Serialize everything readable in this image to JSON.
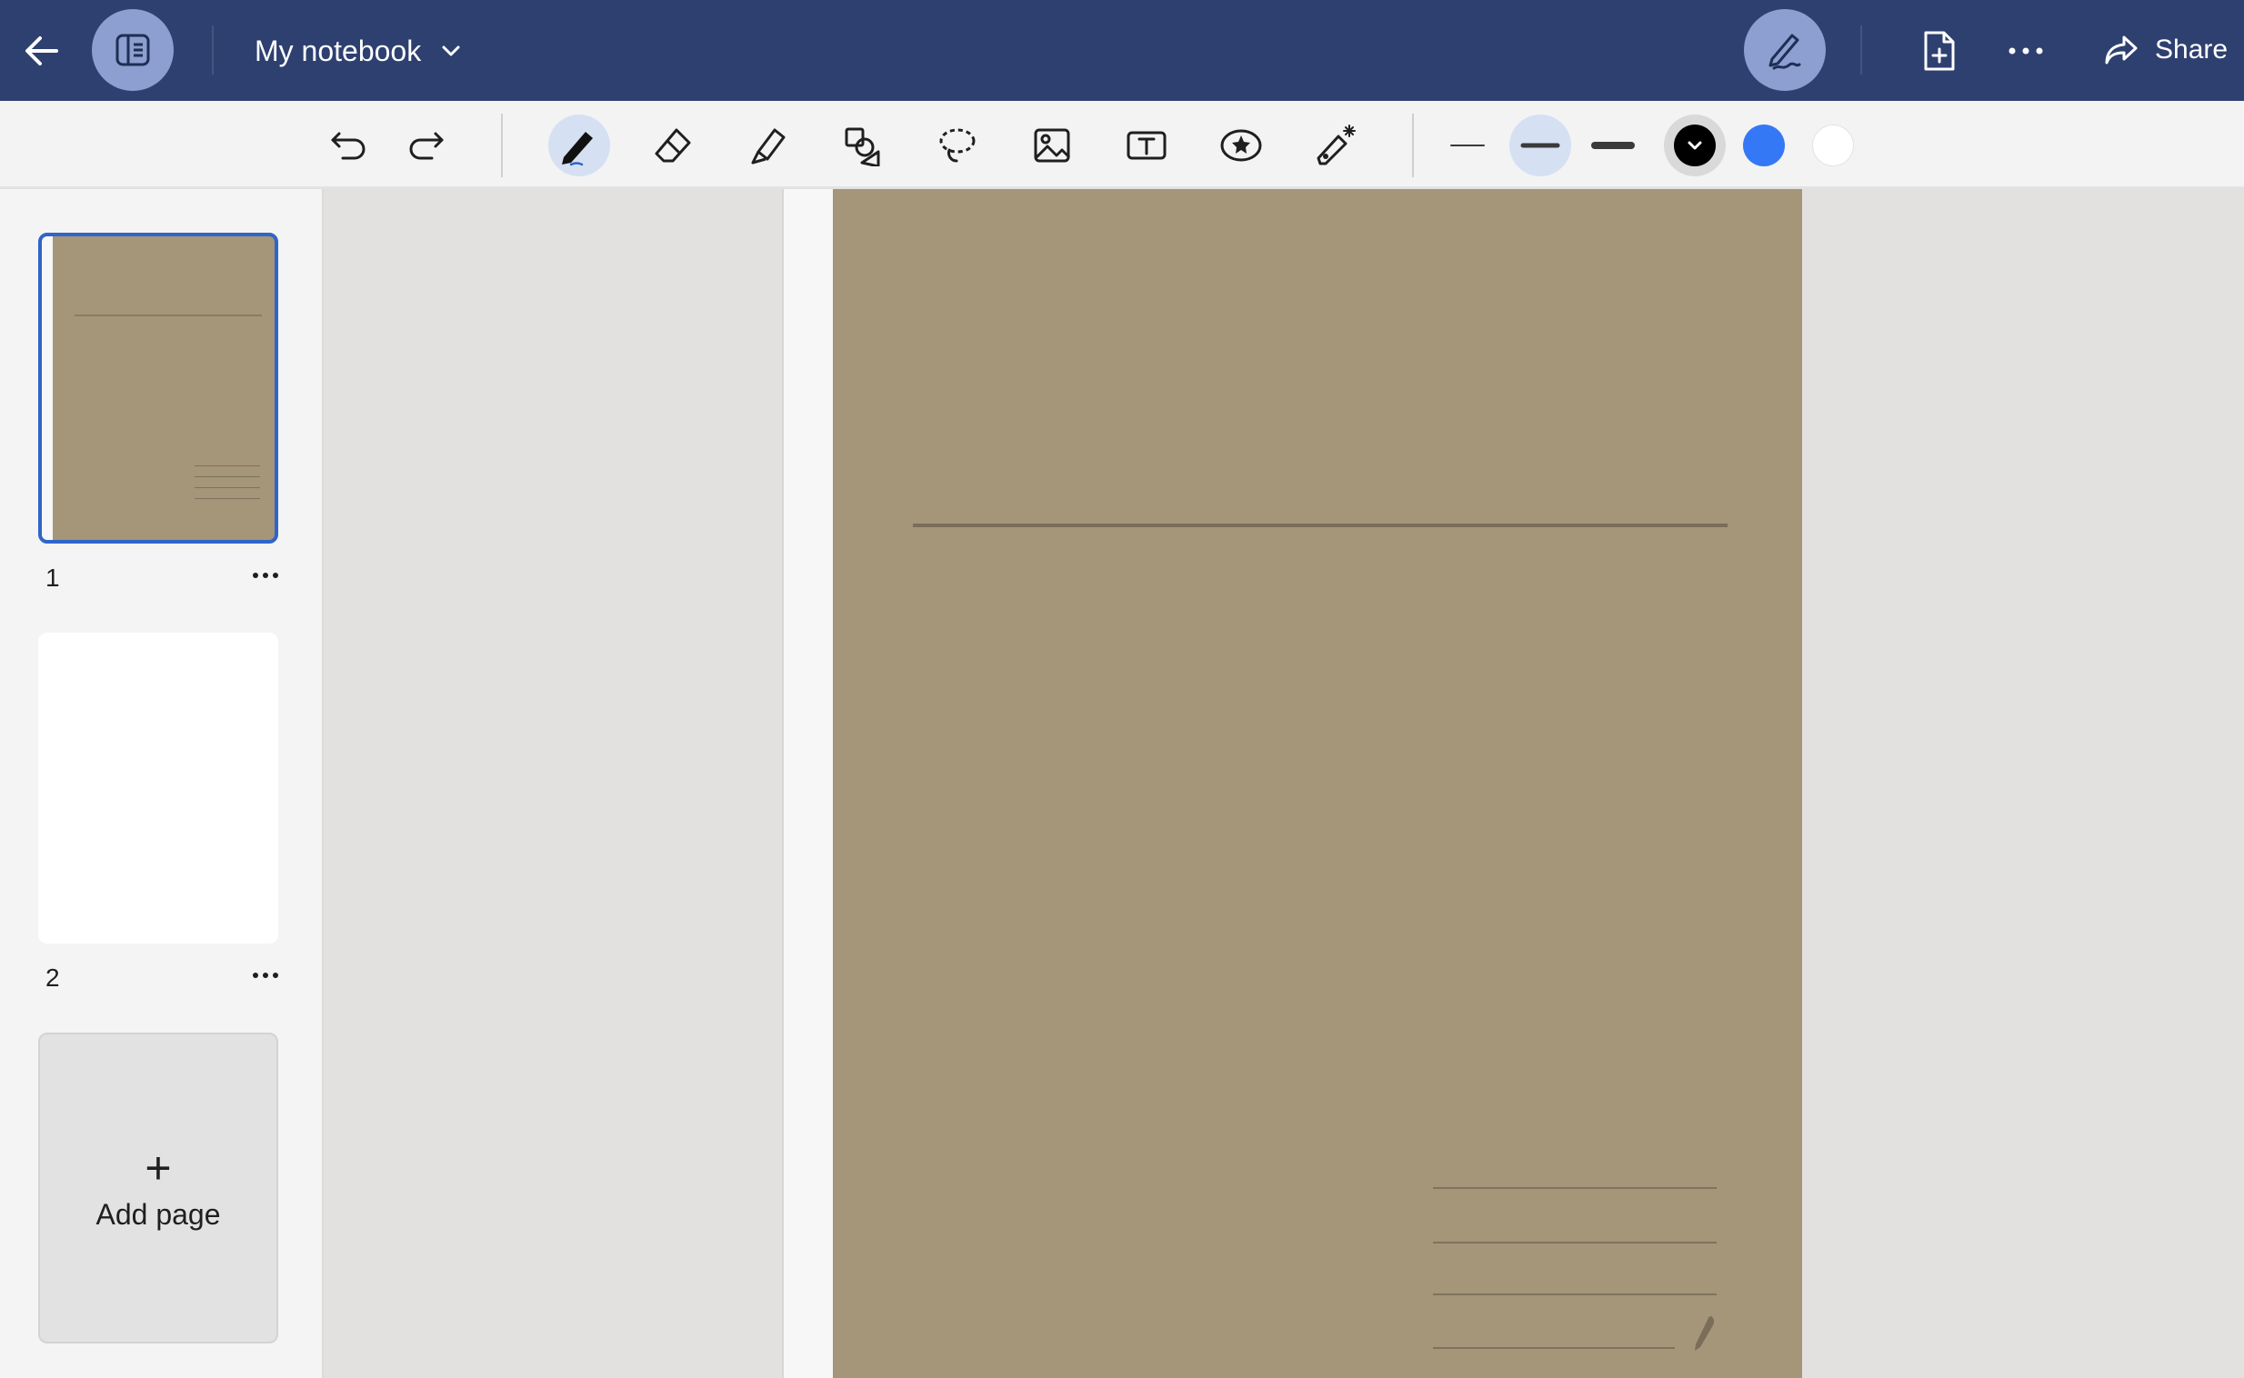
{
  "header": {
    "notebook_title": "My notebook",
    "share_label": "Share"
  },
  "icons": {
    "back": "arrow-left-icon",
    "sidebar_toggle": "sidebar-panel-icon",
    "title_dropdown": "chevron-down-icon",
    "pen_mode": "pen-edit-icon",
    "add_file": "file-plus-icon",
    "more": "more-horizontal-icon",
    "share": "share-arrow-icon"
  },
  "toolbar": {
    "history": [
      "undo-icon",
      "redo-icon"
    ],
    "tools": [
      {
        "name": "pen",
        "icon": "pen-icon",
        "active": true
      },
      {
        "name": "eraser",
        "icon": "eraser-icon",
        "active": false
      },
      {
        "name": "highlighter",
        "icon": "highlighter-icon",
        "active": false
      },
      {
        "name": "shapes",
        "icon": "shapes-icon",
        "active": false
      },
      {
        "name": "lasso",
        "icon": "lasso-icon",
        "active": false
      },
      {
        "name": "image",
        "icon": "image-icon",
        "active": false
      },
      {
        "name": "text",
        "icon": "text-box-icon",
        "active": false
      },
      {
        "name": "sticker",
        "icon": "sticker-icon",
        "active": false
      },
      {
        "name": "magic",
        "icon": "magic-pen-icon",
        "active": false
      }
    ],
    "thickness": [
      {
        "name": "thin",
        "active": false
      },
      {
        "name": "medium",
        "active": true
      },
      {
        "name": "thick",
        "active": false
      }
    ],
    "colors": [
      {
        "name": "black",
        "hex": "#000000",
        "active": true
      },
      {
        "name": "blue",
        "hex": "#3478f6",
        "active": false
      },
      {
        "name": "white",
        "hex": "#ffffff",
        "active": false
      }
    ]
  },
  "sidebar": {
    "pages": [
      {
        "number": "1",
        "selected": true
      },
      {
        "number": "2",
        "selected": false
      }
    ],
    "add_page_label": "Add page",
    "add_page_icon": "plus-icon"
  },
  "colors": {
    "header_bg": "#2e4070",
    "accent_circle": "#8c9fd0",
    "selected_border": "#2f65c9",
    "paper": "#a59579"
  }
}
